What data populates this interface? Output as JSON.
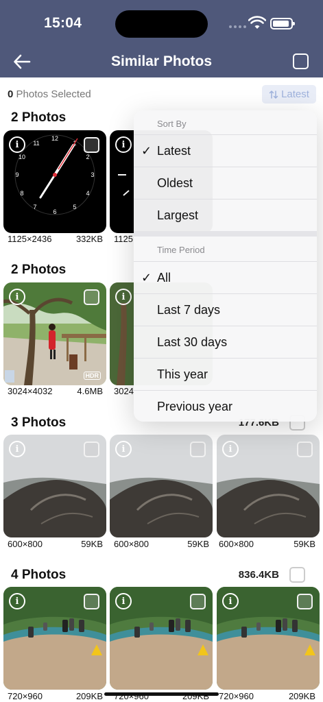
{
  "status_bar": {
    "time": "15:04"
  },
  "nav": {
    "title": "Similar Photos"
  },
  "selection": {
    "count": "0",
    "label": "Photos Selected"
  },
  "sort_button": {
    "label": "Latest"
  },
  "groups": [
    {
      "title": "2 Photos",
      "size": "",
      "photos": [
        {
          "dims": "1125×2436",
          "size": "332KB"
        },
        {
          "dims": "1125",
          "size": ""
        }
      ]
    },
    {
      "title": "2 Photos",
      "size": "",
      "photos": [
        {
          "dims": "3024×4032",
          "size": "4.6MB",
          "badge": "HDR"
        },
        {
          "dims": "3024",
          "size": ""
        }
      ]
    },
    {
      "title": "3 Photos",
      "size": "177.6KB",
      "photos": [
        {
          "dims": "600×800",
          "size": "59KB"
        },
        {
          "dims": "600×800",
          "size": "59KB"
        },
        {
          "dims": "600×800",
          "size": "59KB"
        }
      ]
    },
    {
      "title": "4 Photos",
      "size": "836.4KB",
      "photos": [
        {
          "dims": "720×960",
          "size": "209KB"
        },
        {
          "dims": "720×960",
          "size": "209KB"
        },
        {
          "dims": "720×960",
          "size": "209KB"
        }
      ]
    }
  ],
  "menu": {
    "sort_header": "Sort By",
    "sort_options": [
      "Latest",
      "Oldest",
      "Largest"
    ],
    "sort_selected": "Latest",
    "period_header": "Time Period",
    "period_options": [
      "All",
      "Last 7 days",
      "Last 30 days",
      "This year",
      "Previous year"
    ],
    "period_selected": "All",
    "check_glyph": "✓"
  },
  "thumb": {
    "info_glyph": "i"
  },
  "icons": {
    "back": "back-arrow-icon",
    "select_all": "checkbox-icon",
    "sort": "sort-arrows-icon",
    "wifi": "wifi-icon",
    "battery": "battery-icon",
    "info": "info-icon"
  }
}
